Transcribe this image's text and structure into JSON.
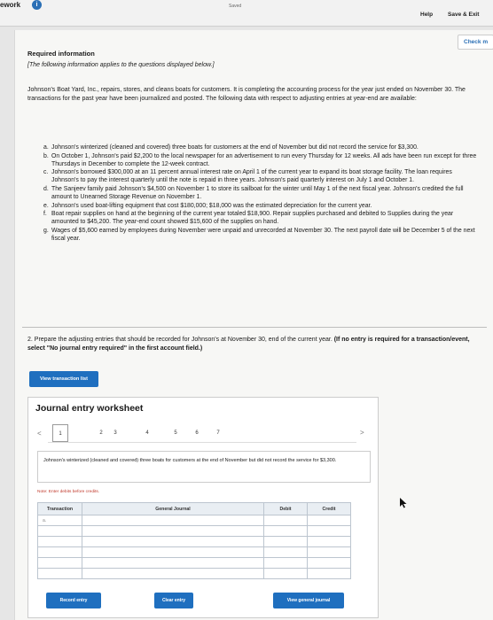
{
  "header": {
    "app_title": "ework",
    "info_icon": "i",
    "saved_label": "Saved",
    "help_label": "Help",
    "save_exit_label": "Save & Exit"
  },
  "check_label": "Check m",
  "required": {
    "title": "Required information",
    "note": "[The following information applies to the questions displayed below.]",
    "intro": "Johnson's Boat Yard, Inc., repairs, stores, and cleans boats for customers. It is completing the accounting process for the year just ended on November 30. The transactions for the past year have been journalized and posted. The following data with respect to adjusting entries at year-end are available:",
    "items": [
      {
        "letter": "a.",
        "text": "Johnson's winterized (cleaned and covered) three boats for customers at the end of November but did not record the service for $3,300."
      },
      {
        "letter": "b.",
        "text": "On October 1, Johnson's paid $2,200 to the local newspaper for an advertisement to run every Thursday for 12 weeks. All ads have been run except for three Thursdays in December to complete the 12-week contract."
      },
      {
        "letter": "c.",
        "text": "Johnson's borrowed $300,000 at an 11 percent annual interest rate on April 1 of the current year to expand its boat storage facility. The loan requires Johnson's to pay the interest quarterly until the note is repaid in three years. Johnson's paid quarterly interest on July 1 and October 1."
      },
      {
        "letter": "d.",
        "text": "The Sanjeev family paid Johnson's $4,500 on November 1 to store its sailboat for the winter until May 1 of the next fiscal year. Johnson's credited the full amount to Unearned Storage Revenue on November 1."
      },
      {
        "letter": "e.",
        "text": "Johnson's used boat-lifting equipment that cost $180,000; $18,000 was the estimated depreciation for the current year."
      },
      {
        "letter": "f.",
        "text": "Boat repair supplies on hand at the beginning of the current year totaled $18,900. Repair supplies purchased and debited to Supplies during the year amounted to $45,200. The year-end count showed $15,600 of the supplies on hand."
      },
      {
        "letter": "g.",
        "text": "Wages of $5,600 earned by employees during November were unpaid and unrecorded at November 30. The next payroll date will be December 5 of the next fiscal year."
      }
    ]
  },
  "question": {
    "text": "2. Prepare the adjusting entries that should be recorded for Johnson's at November 30, end of the current year.",
    "bold_text": "(If no entry is required for a transaction/event, select \"No journal entry required\" in the first account field.)"
  },
  "view_transaction_label": "View transaction list",
  "worksheet": {
    "title": "Journal entry worksheet",
    "prev_icon": "<",
    "next_icon": ">",
    "tabs": [
      "1",
      "2",
      "3",
      "4",
      "5",
      "6",
      "7"
    ],
    "description": "Johnson's winterized (cleaned and covered) three boats for customers at the end of November but did not record the service for $3,300.",
    "note": "Note: Enter debits before credits.",
    "columns": [
      "Transaction",
      "General Journal",
      "Debit",
      "Credit"
    ],
    "first_row_label": "a.",
    "record_label": "Record entry",
    "clear_label": "Clear entry",
    "view_gj_label": "View general journal"
  },
  "colors": {
    "accent": "#1f6fbf",
    "info": "#2a6fb5",
    "note_red": "#c0392b"
  }
}
